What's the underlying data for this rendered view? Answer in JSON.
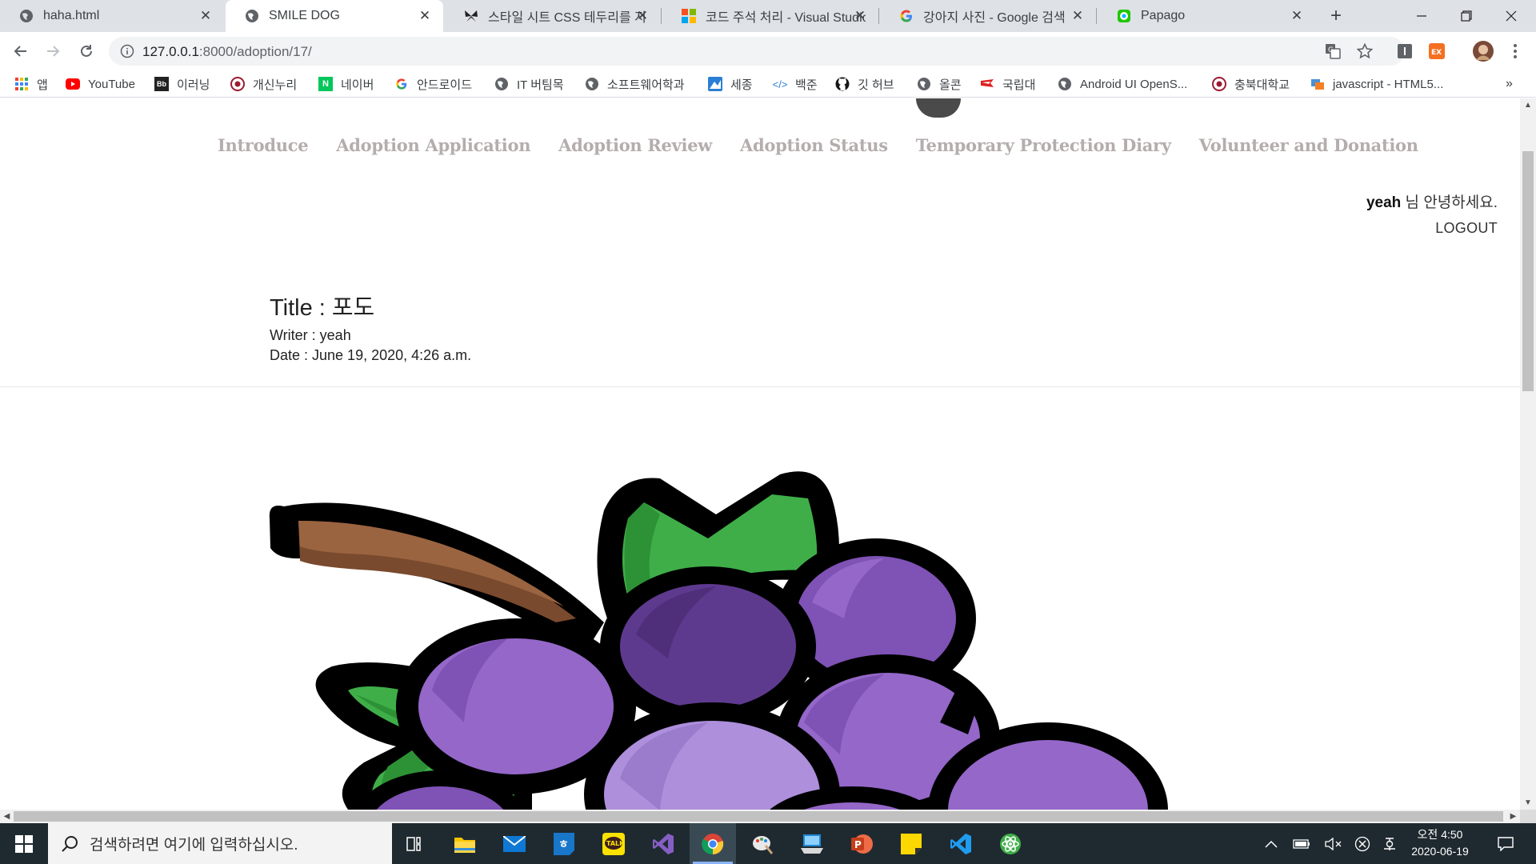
{
  "browser": {
    "tabs": [
      {
        "title": "haha.html",
        "favicon": "globe-icon",
        "active": false
      },
      {
        "title": "SMILE DOG",
        "favicon": "globe-icon",
        "active": true
      },
      {
        "title": "스타일 시트 CSS 테두리를 지",
        "favicon": "butterfly-icon",
        "active": false
      },
      {
        "title": "코드 주석 처리 - Visual Studio",
        "favicon": "microsoft-icon",
        "active": false
      },
      {
        "title": "강아지 사진 - Google 검색",
        "favicon": "google-icon",
        "active": false
      },
      {
        "title": "Papago",
        "favicon": "papago-icon",
        "active": false
      }
    ],
    "address": {
      "host": "127.0.0.1",
      "path": ":8000/adoption/17/"
    },
    "bookmarks": [
      {
        "label": "앱",
        "icon": "apps-grid-icon"
      },
      {
        "label": "YouTube",
        "icon": "youtube-icon"
      },
      {
        "label": "이러닝",
        "icon": "bs-icon"
      },
      {
        "label": "개신누리",
        "icon": "university-seal-icon"
      },
      {
        "label": "네이버",
        "icon": "naver-icon"
      },
      {
        "label": "안드로이드",
        "icon": "google-icon"
      },
      {
        "label": "IT 버팀목",
        "icon": "globe-icon"
      },
      {
        "label": "소프트웨어학과",
        "icon": "globe-icon"
      },
      {
        "label": "세종",
        "icon": "sejong-icon"
      },
      {
        "label": "백준",
        "icon": "code-icon"
      },
      {
        "label": "깃 허브",
        "icon": "github-icon"
      },
      {
        "label": "올콘",
        "icon": "globe-icon"
      },
      {
        "label": "국립대",
        "icon": "flag-icon"
      },
      {
        "label": "Android UI OpenS...",
        "icon": "globe-icon"
      },
      {
        "label": "충북대학교",
        "icon": "university-seal-icon"
      },
      {
        "label": "javascript - HTML5...",
        "icon": "stackoverflow-icon"
      }
    ],
    "bookmarks_overflow": "»",
    "extension_badge": "EX"
  },
  "page": {
    "nav": [
      "Introduce",
      "Adoption Application",
      "Adoption Review",
      "Adoption Status",
      "Temporary Protection Diary",
      "Volunteer and Donation"
    ],
    "user": {
      "name": "yeah",
      "greeting_suffix": " 님 안녕하세요."
    },
    "logout_label": "LOGOUT",
    "post": {
      "title": "Title : 포도",
      "writer": "Writer : yeah",
      "date": "Date : June 19, 2020, 4:26 a.m.",
      "image": "grapes-illustration"
    }
  },
  "taskbar": {
    "search_placeholder": "검색하려면 여기에 입력하십시오.",
    "apps": [
      "task-view-icon",
      "file-explorer-icon",
      "mail-icon",
      "hancom-icon",
      "kakaotalk-icon",
      "visual-studio-icon",
      "chrome-icon",
      "paint-icon",
      "remote-desktop-icon",
      "powerpoint-icon",
      "sticky-notes-icon",
      "vscode-icon",
      "atom-icon"
    ],
    "kakaotalk_label": "TALK",
    "clock": {
      "period_time": "오전 4:50",
      "date": "2020-06-19"
    },
    "colors": {
      "taskbar": "#1f2a30",
      "nav_text": "#b5adad",
      "grape": "#9467c9",
      "leaf": "#3fae48"
    }
  }
}
